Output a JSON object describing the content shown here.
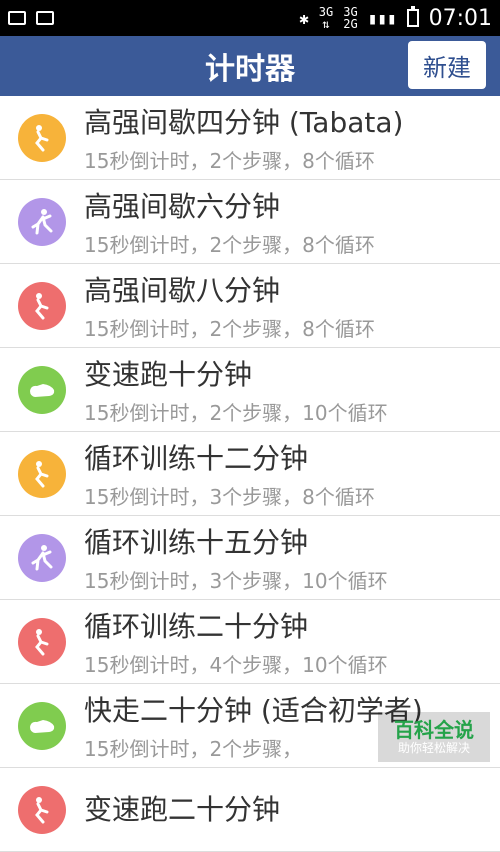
{
  "status_bar": {
    "time": "07:01",
    "net1": "3G",
    "net2_top": "3G",
    "net2_bottom": "2G"
  },
  "header": {
    "title": "计时器",
    "new_button": "新建"
  },
  "items": [
    {
      "title": "高强间歇四分钟 (Tabata)",
      "subtitle": "15秒倒计时，2个步骤，8个循环",
      "icon": "hiit-icon",
      "color": "#f7b33a"
    },
    {
      "title": "高强间歇六分钟",
      "subtitle": "15秒倒计时，2个步骤，8个循环",
      "icon": "kick-icon",
      "color": "#b296e8"
    },
    {
      "title": "高强间歇八分钟",
      "subtitle": "15秒倒计时，2个步骤，8个循环",
      "icon": "hiit-icon",
      "color": "#ee6e6e"
    },
    {
      "title": "变速跑十分钟",
      "subtitle": "15秒倒计时，2个步骤，10个循环",
      "icon": "shoe-icon",
      "color": "#80cc4f"
    },
    {
      "title": "循环训练十二分钟",
      "subtitle": "15秒倒计时，3个步骤，8个循环",
      "icon": "hiit-icon",
      "color": "#f7b33a"
    },
    {
      "title": "循环训练十五分钟",
      "subtitle": "15秒倒计时，3个步骤，10个循环",
      "icon": "kick-icon",
      "color": "#b296e8"
    },
    {
      "title": "循环训练二十分钟",
      "subtitle": "15秒倒计时，4个步骤，10个循环",
      "icon": "hiit-icon",
      "color": "#ee6e6e"
    },
    {
      "title": "快走二十分钟 (适合初学者)",
      "subtitle": "15秒倒计时，2个步骤，",
      "icon": "shoe-icon",
      "color": "#80cc4f"
    },
    {
      "title": "变速跑二十分钟",
      "subtitle": "",
      "icon": "hiit-icon",
      "color": "#ee6e6e"
    }
  ],
  "watermark": {
    "title": "百科全说",
    "subtitle": "助你轻松解决"
  }
}
